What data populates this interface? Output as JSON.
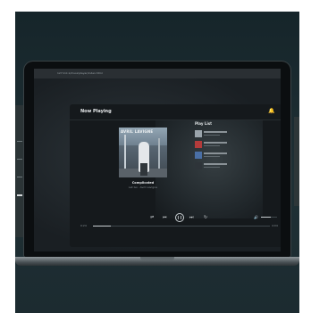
{
  "browser": {
    "url": "127.0.0.1/musicplayer/index.html"
  },
  "app": {
    "title": "Now Playing",
    "bell_icon": "bell-icon",
    "gear_icon": "gear-icon",
    "cover_text": "AVRIL LAVIGNE",
    "song_title": "Complicated",
    "artist": "Let Go · Avril Lavigne",
    "playlist_title": "Play List",
    "time_elapsed": "0:24",
    "time_total": "4:04",
    "progress": 0.1,
    "volume": 0.6
  },
  "playlist": [
    {
      "thumb_color": "#9aa4ab"
    },
    {
      "thumb_color": "#b33b3b"
    },
    {
      "thumb_color": "#4a6fa5"
    },
    {
      "thumb_color": "#2e3439"
    }
  ],
  "colors": {
    "frame_bg": "#1b2a2e",
    "app_bg": "#15191c",
    "accent": "#c9cfd2"
  }
}
